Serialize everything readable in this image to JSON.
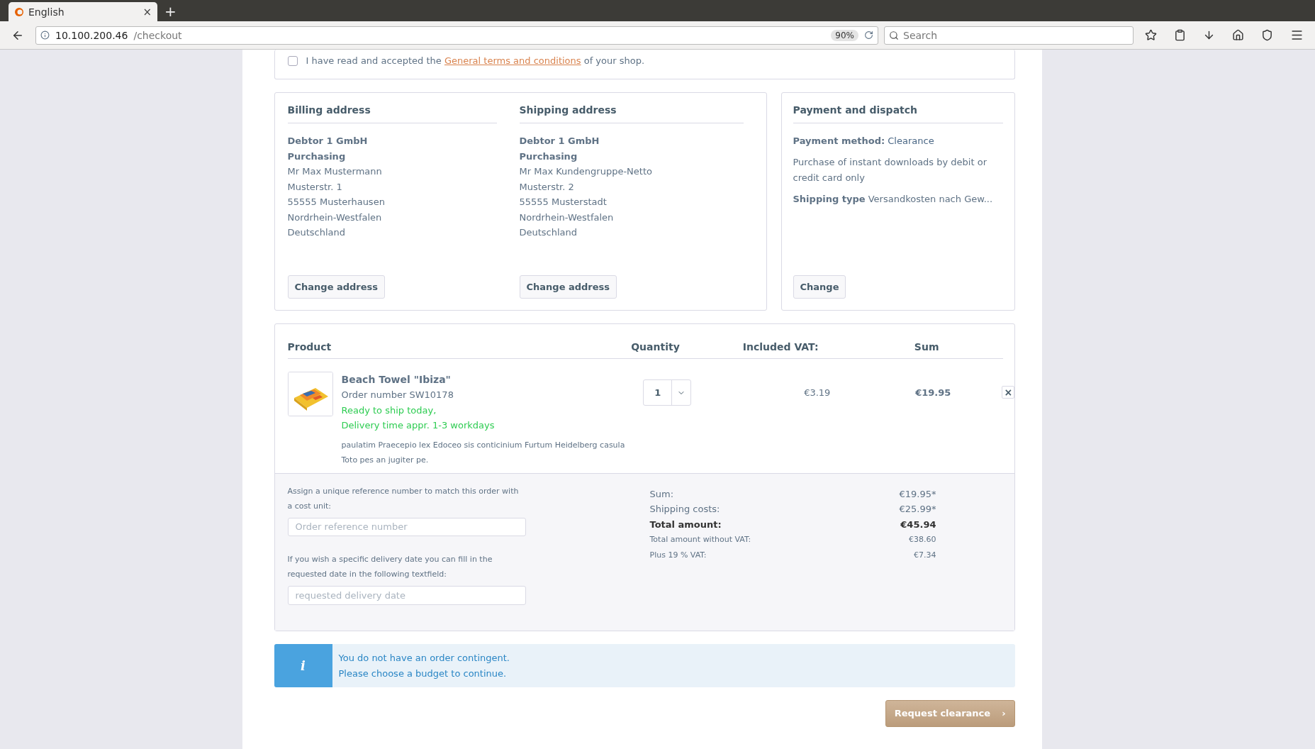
{
  "browser": {
    "tab_title": "English",
    "tab_close": "×",
    "new_tab": "+",
    "url_host": "10.100.200.46",
    "url_path": "/checkout",
    "zoom": "90%",
    "search_placeholder": "Search"
  },
  "terms": {
    "checked": false,
    "before": "I have read and accepted the ",
    "link": "General terms and conditions",
    "after": " of your shop."
  },
  "addresses": [
    {
      "heading": "Billing address",
      "lines": [
        {
          "text": "Debtor 1 GmbH",
          "bold": true
        },
        {
          "text": "Purchasing",
          "bold": true
        },
        {
          "text": "Mr Max Mustermann",
          "bold": false
        },
        {
          "text": "Musterstr. 1",
          "bold": false
        },
        {
          "text": "55555 Musterhausen",
          "bold": false
        },
        {
          "text": "Nordrhein-Westfalen",
          "bold": false
        },
        {
          "text": "Deutschland",
          "bold": false
        }
      ],
      "button": "Change address"
    },
    {
      "heading": "Shipping address",
      "lines": [
        {
          "text": "Debtor 1 GmbH",
          "bold": true
        },
        {
          "text": "Purchasing",
          "bold": true
        },
        {
          "text": "Mr Max Kundengruppe-Netto",
          "bold": false
        },
        {
          "text": "Musterstr. 2",
          "bold": false
        },
        {
          "text": "55555 Musterstadt",
          "bold": false
        },
        {
          "text": "Nordrhein-Westfalen",
          "bold": false
        },
        {
          "text": "Deutschland",
          "bold": false
        }
      ],
      "button": "Change address"
    }
  ],
  "payment": {
    "heading": "Payment and dispatch",
    "method_label": "Payment method:",
    "method_value": "Clearance",
    "description": "Purchase of instant downloads by debit or credit card only",
    "shipping_label": "Shipping type",
    "shipping_value": "Versandkosten nach Gew...",
    "button": "Change"
  },
  "cart": {
    "columns": [
      "Product",
      "Quantity",
      "Included VAT:",
      "Sum"
    ],
    "items": [
      {
        "name": "Beach Towel \"Ibiza\"",
        "order_number": "Order number SW10178",
        "availability": [
          "Ready to ship today,",
          "Delivery time appr. 1-3 workdays"
        ],
        "description": [
          "paulatim Praecepio lex Edoceo sis conticinium Furtum Heidelberg casula",
          "Toto pes an jugiter pe."
        ],
        "quantity": "1",
        "vat": "€3.19",
        "sum": "€19.95",
        "remove": "×"
      }
    ]
  },
  "reference": {
    "label": "Assign a unique reference number to match this order with a cost unit:",
    "placeholder": "Order reference number"
  },
  "delivery_date": {
    "label": "If you wish a specific delivery date you can fill in the requested date in the following textfield:",
    "placeholder": "requested delivery date"
  },
  "totals": [
    {
      "label": "Sum:",
      "value": "€19.95*",
      "kind": "normal"
    },
    {
      "label": "Shipping costs:",
      "value": "€25.99*",
      "kind": "normal"
    },
    {
      "label": "Total amount:",
      "value": "€45.94",
      "kind": "total"
    },
    {
      "label": "Total amount without VAT:",
      "value": "€38.60",
      "kind": "small"
    },
    {
      "label": "Plus 19 % VAT:",
      "value": "€7.34",
      "kind": "small"
    }
  ],
  "notice": {
    "icon": "i",
    "lines": [
      "You do not have an order contingent.",
      "Please choose a budget to continue."
    ]
  },
  "submit": "Request clearance",
  "submit_arrow": "›"
}
